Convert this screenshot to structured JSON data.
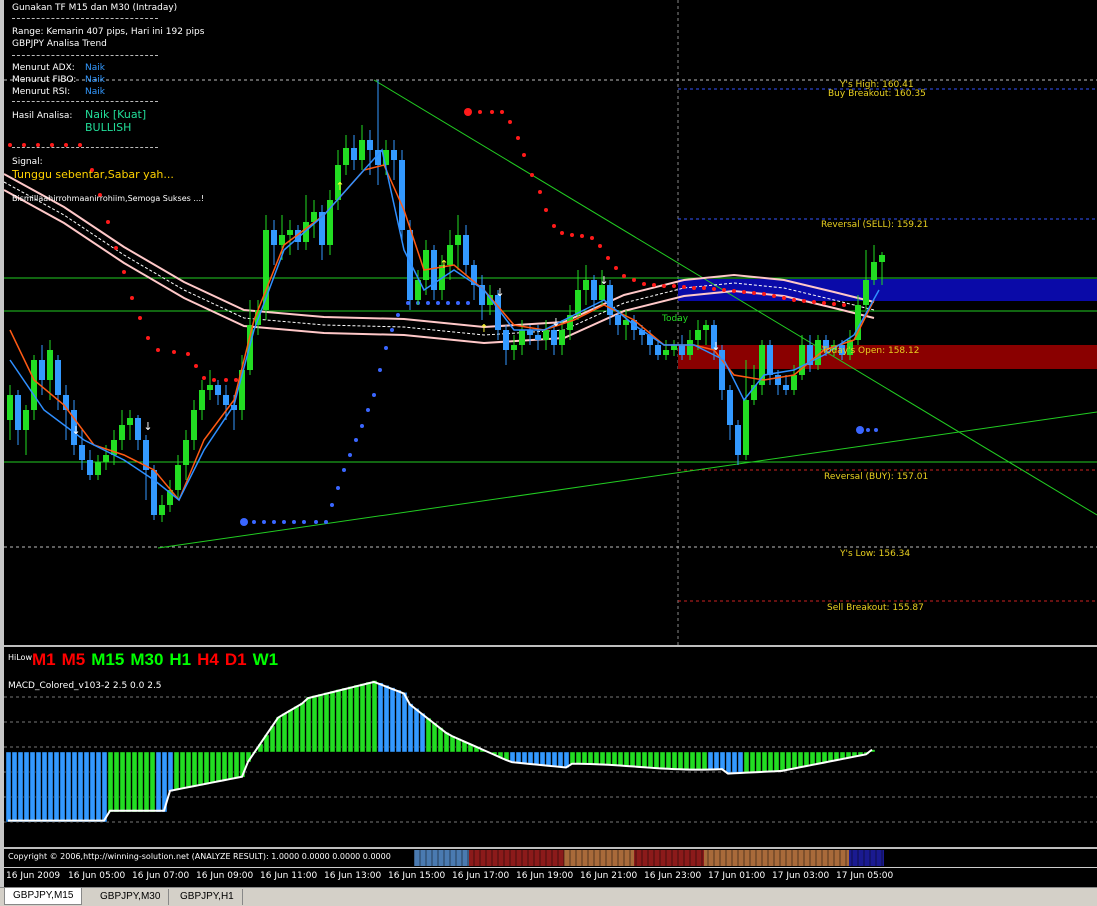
{
  "info_panel": {
    "line1": "Gunakan TF M15 dan M30 (Intraday)",
    "range": "Range: Kemarin 407 pips, Hari ini 192 pips",
    "pair_trend": "GBPJPY Analisa Trend",
    "adx_label": "Menurut ADX:",
    "adx_value": "Naik",
    "fibo_label": "Menurut FIBO:",
    "fibo_value": "Naik",
    "rsi_label": "Menurut RSI:",
    "rsi_value": "Naik",
    "hasil_label": "Hasil Analisa:",
    "hasil_value": "Naik  [Kuat]",
    "hasil_signal": "BULLISH",
    "signal_label": "Signal:",
    "signal_text": "Tunggu sebentar,Sabar yah...",
    "doa": "Bismillaahirrohmaanirrohiim,Semoga Sukses ...!"
  },
  "levels": {
    "ys_high": "Y's High: 160.41",
    "buy_breakout": "Buy Breakout: 160.35",
    "reversal_sell": "Reversal (SELL): 159.21",
    "today": "Today",
    "todays_open": "Today's Open: 158.12",
    "reversal_buy": "Reversal (BUY): 157.01",
    "ys_low": "Y's Low: 156.34",
    "sell_breakout": "Sell Breakout: 155.87"
  },
  "hilow": {
    "label": "HiLow",
    "timeframes": [
      {
        "tf": "M1",
        "color": "#ff0000"
      },
      {
        "tf": "M5",
        "color": "#ff0000"
      },
      {
        "tf": "M15",
        "color": "#00ff00"
      },
      {
        "tf": "M30",
        "color": "#00ff00"
      },
      {
        "tf": "H1",
        "color": "#00ff00"
      },
      {
        "tf": "H4",
        "color": "#ff0000"
      },
      {
        "tf": "D1",
        "color": "#ff0000"
      },
      {
        "tf": "W1",
        "color": "#00ff00"
      }
    ]
  },
  "macd": {
    "title": "MACD_Colored_v103-2 2.5 0.0 2.5"
  },
  "copyright": "Copyright © 2006,http://winning-solution.net (ANALYZE RESULT): 1.0000 0.0000 0.0000 0.0000",
  "xaxis": [
    "16 Jun 2009",
    "16 Jun 05:00",
    "16 Jun 07:00",
    "16 Jun 09:00",
    "16 Jun 11:00",
    "16 Jun 13:00",
    "16 Jun 15:00",
    "16 Jun 17:00",
    "16 Jun 19:00",
    "16 Jun 21:00",
    "16 Jun 23:00",
    "17 Jun 01:00",
    "17 Jun 03:00",
    "17 Jun 05:00"
  ],
  "tabs": [
    "GBPJPY,M15",
    "GBPJPY,M30",
    "GBPJPY,H1"
  ],
  "colors": {
    "bull": "#22dd22",
    "bear": "#3399ff",
    "red_sar": "#ff1a1a",
    "blue_sar": "#3a66ff",
    "band_blue": "#0a0aa8",
    "band_red": "#8a0000",
    "trend": "#22cc22",
    "level": "#cc2222"
  }
}
